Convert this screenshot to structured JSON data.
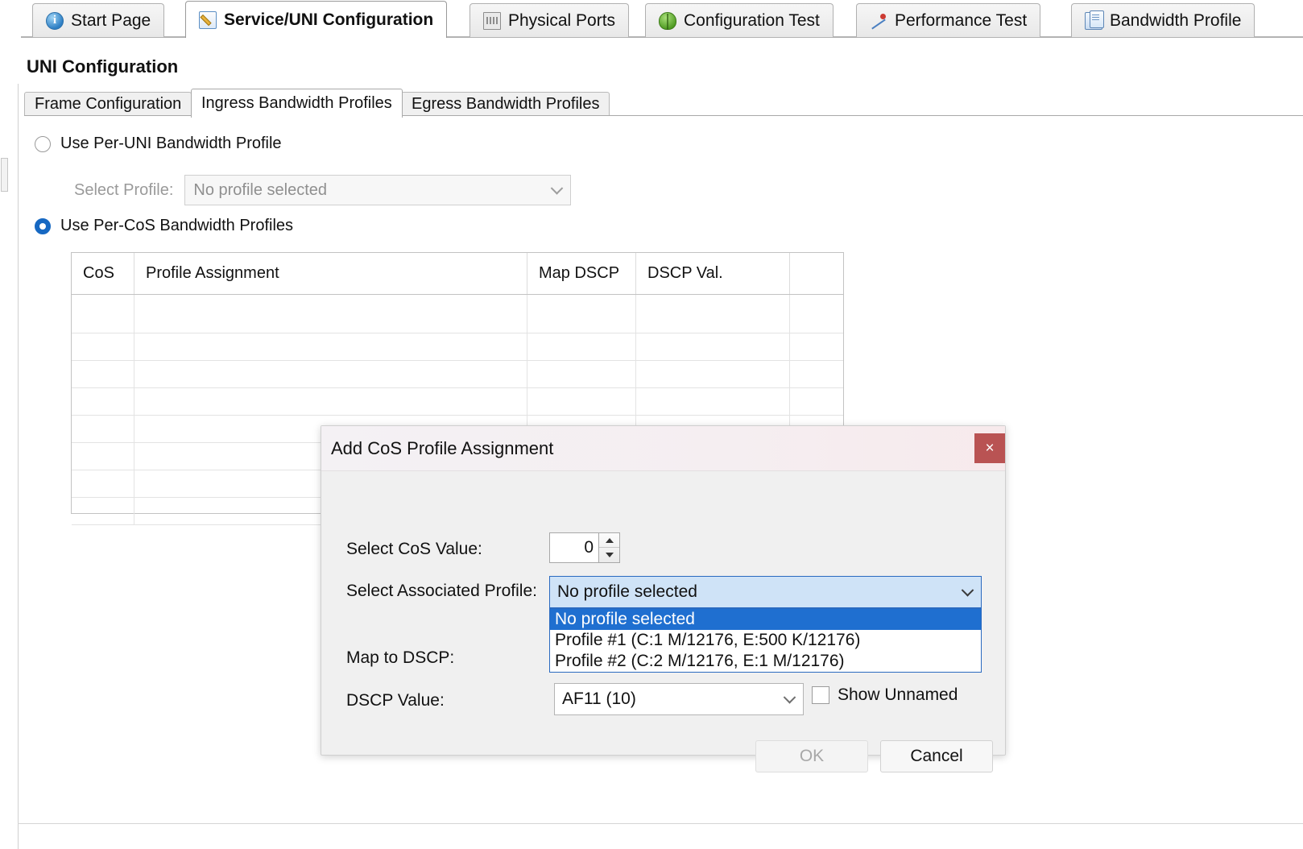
{
  "window": {
    "tabs": [
      {
        "label": "Start Page",
        "icon": "info-icon",
        "active": false
      },
      {
        "label": "Service/UNI Configuration",
        "icon": "edit-document-icon",
        "active": true
      },
      {
        "label": "Physical Ports",
        "icon": "ports-icon",
        "active": false
      },
      {
        "label": "Configuration Test",
        "icon": "bug-icon",
        "active": false
      },
      {
        "label": "Performance Test",
        "icon": "performance-chart-icon",
        "active": false
      },
      {
        "label": "Bandwidth Profile",
        "icon": "documents-icon",
        "active": false
      }
    ]
  },
  "page": {
    "title": "UNI Configuration",
    "subtabs": [
      {
        "label": "Frame Configuration",
        "active": false
      },
      {
        "label": "Ingress Bandwidth Profiles",
        "active": true
      },
      {
        "label": "Egress Bandwidth Profiles",
        "active": false
      }
    ]
  },
  "form": {
    "per_uni_radio_label": "Use Per-UNI Bandwidth Profile",
    "per_uni_selected": false,
    "select_profile_label": "Select Profile:",
    "select_profile_value": "No profile selected",
    "per_cos_radio_label": "Use Per-CoS Bandwidth Profiles",
    "per_cos_selected": true
  },
  "grid": {
    "columns": [
      "CoS",
      "Profile Assignment",
      "Map DSCP",
      "DSCP Val.",
      ""
    ],
    "rows": [
      [],
      [],
      [],
      [],
      [],
      [],
      [],
      []
    ]
  },
  "dialog": {
    "title": "Add CoS Profile Assignment",
    "close_label": "×",
    "cos_label": "Select CoS Value:",
    "cos_value": "0",
    "spin_up": "▲",
    "spin_down": "▼",
    "profile_label": "Select Associated Profile:",
    "profile_value": "No profile selected",
    "profile_options": [
      "No profile selected",
      "Profile #1 (C:1 M/12176, E:500 K/12176)",
      "Profile #2 (C:2 M/12176, E:1 M/12176)"
    ],
    "profile_selected_index": 0,
    "map_dscp_label": "Map to DSCP:",
    "dscp_value_label": "DSCP Value:",
    "dscp_value": "AF11 (10)",
    "show_unnamed_label": "Show Unnamed",
    "show_unnamed_checked": false,
    "ok_label": "OK",
    "ok_enabled": false,
    "cancel_label": "Cancel"
  },
  "colors": {
    "accent_blue": "#1f6fd0",
    "radio_blue": "#1668c2",
    "close_red": "#b95353",
    "combo_highlight": "#cfe3f7"
  }
}
